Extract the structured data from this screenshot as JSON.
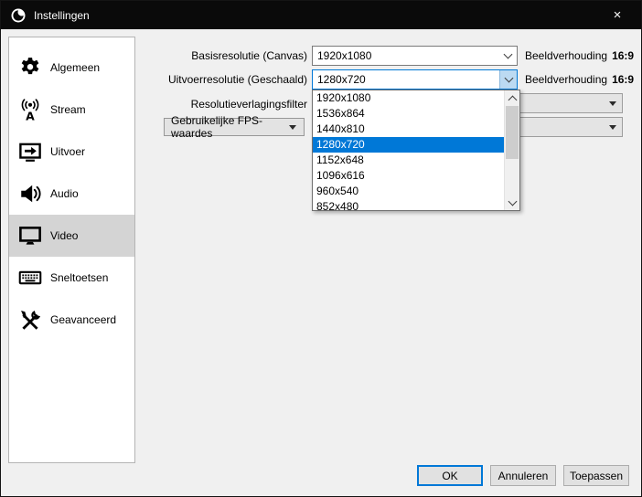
{
  "window": {
    "title": "Instellingen",
    "close_glyph": "×"
  },
  "sidebar": {
    "selected_index": 4,
    "items": [
      {
        "label": "Algemeen",
        "icon": "gear"
      },
      {
        "label": "Stream",
        "icon": "broadcast"
      },
      {
        "label": "Uitvoer",
        "icon": "output-arrow"
      },
      {
        "label": "Audio",
        "icon": "speaker"
      },
      {
        "label": "Video",
        "icon": "monitor"
      },
      {
        "label": "Sneltoetsen",
        "icon": "keyboard"
      },
      {
        "label": "Geavanceerd",
        "icon": "tools"
      }
    ]
  },
  "video_settings": {
    "base_resolution": {
      "label": "Basisresolutie (Canvas)",
      "value": "1920x1080",
      "aspect_label": "Beeldverhouding",
      "aspect_value": "16:9"
    },
    "output_resolution": {
      "label": "Uitvoerresolutie (Geschaald)",
      "value": "1280x720",
      "aspect_label": "Beeldverhouding",
      "aspect_value": "16:9"
    },
    "downscale_filter": {
      "label": "Resolutieverlagingsfilter"
    },
    "fps": {
      "button_label": "Gebruikelijke FPS-waardes"
    },
    "dropdown": {
      "selected": "1280x720",
      "selected_index": 3,
      "options": [
        "1920x1080",
        "1536x864",
        "1440x810",
        "1280x720",
        "1152x648",
        "1096x616",
        "960x540",
        "852x480"
      ]
    }
  },
  "footer": {
    "ok": "OK",
    "cancel": "Annuleren",
    "apply": "Toepassen"
  },
  "colors": {
    "accent": "#0078d7",
    "titlebar": "#0a0a0a",
    "selection": "#0078d7"
  }
}
